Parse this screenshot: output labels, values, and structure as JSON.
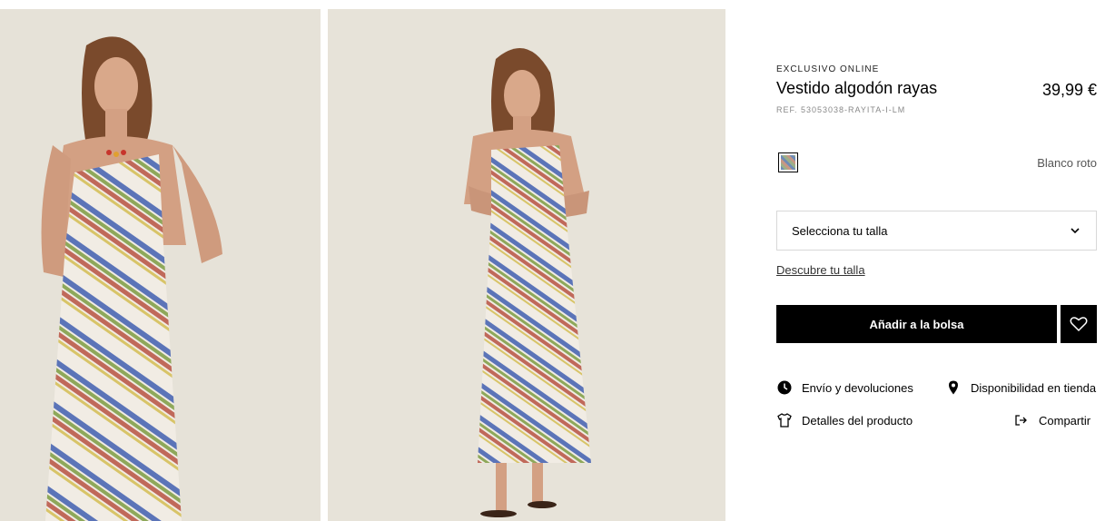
{
  "product": {
    "badge": "EXCLUSIVO ONLINE",
    "name": "Vestido algodón rayas",
    "price": "39,99 €",
    "ref": "REF. 53053038-RAYITA-I-LM",
    "color_name": "Blanco roto"
  },
  "size_select": {
    "placeholder": "Selecciona tu talla"
  },
  "size_guide_label": "Descubre tu talla",
  "add_to_bag_label": "Añadir a la bolsa",
  "links": {
    "shipping": "Envío y devoluciones",
    "availability": "Disponibilidad en tienda",
    "details": "Detalles del producto",
    "share": "Compartir"
  },
  "icons": {
    "shipping": "clock-icon",
    "availability": "location-pin-icon",
    "details": "tshirt-icon",
    "share": "share-icon",
    "favorite": "heart-icon",
    "size_select": "chevron-down-icon"
  },
  "colors": {
    "button_bg": "#000000",
    "button_text": "#ffffff",
    "photo_bg": "#e6e2d8",
    "stripe_blue": "#5b74b8",
    "stripe_green": "#8ea85a",
    "stripe_red": "#c0695a",
    "stripe_yellow": "#d8c468"
  }
}
